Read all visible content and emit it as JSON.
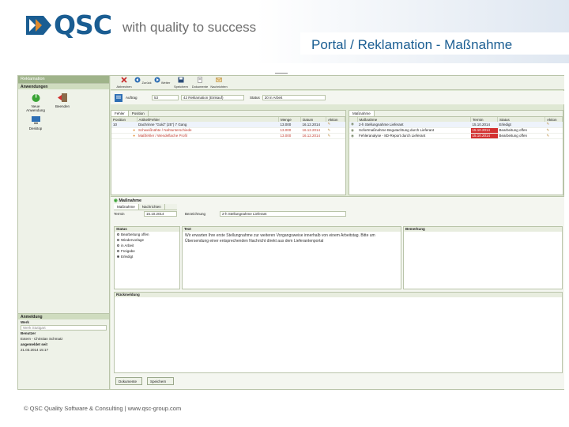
{
  "brand": {
    "name": "QSC",
    "tagline": "with quality to success",
    "color": "#1a5d92"
  },
  "slide": {
    "title": "Portal / Reklamation - Maßnahme",
    "footer": "© QSC Quality Software & Consulting | www.qsc-group.com"
  },
  "app": {
    "left_panel": {
      "title": "Reklamation",
      "section_apps": "Anwendungen",
      "apps": [
        {
          "label": "Neue Anwendung",
          "icon": "power-icon"
        },
        {
          "label": "Beenden",
          "icon": "exit-icon"
        },
        {
          "label": "Desktop",
          "icon": "desktop-icon"
        }
      ],
      "section_login": "Anmeldung",
      "werk_label": "Werk",
      "werk_placeholder": "Werk Stuttgart",
      "benutzer_label": "Benutzer",
      "benutzer_value": "Extern - Christian Schmatz",
      "angemeldet_label": "angemeldet seit",
      "angemeldet_value": "21.03.2014 15:17"
    },
    "toolbar": {
      "buttons": [
        "Abbrechen",
        "Zurück",
        "Weiter",
        "Speichern",
        "Dokumente",
        "Nachrichten"
      ]
    },
    "filter": {
      "auftrag_label": "Auftrag",
      "auftrag_value": "53",
      "reklamation_value": "42 Reklamation (Einkauf)",
      "status_label": "Status",
      "status_value": "20 in Arbeit"
    },
    "defects": {
      "tabs": [
        "Fehler",
        "Position"
      ],
      "columns": [
        "Position",
        "Artikel/Fehler",
        "Menge",
        "Datum",
        "Aktion"
      ],
      "rows": [
        {
          "position": "10",
          "artikel": "Dachrinne \"Gold\" (25\") 7 Gang",
          "menge": "13.000",
          "datum": "16.12.2014",
          "red": false
        },
        {
          "position": "",
          "artikel": "Schweißnähte / Nahtunterschiede",
          "menge": "13.000",
          "datum": "16.12.2014",
          "red": true
        },
        {
          "position": "",
          "artikel": "Maßfehler / Wendeflache Profil",
          "menge": "13.000",
          "datum": "16.12.2014",
          "red": true
        }
      ]
    },
    "measures": {
      "tab": "Maßnahme",
      "columns": [
        "Maßnahme",
        "Termin",
        "Status",
        "Aktion"
      ],
      "rows": [
        {
          "massnahme": "2-h Stellungnahme Lieferant",
          "termin": "15.10.2014",
          "status": "Erledigt",
          "red": false
        },
        {
          "massnahme": "Sofortmaßnahme Begutachtung durch Lieferant",
          "termin": "15.10.2014",
          "status": "Bearbeitung offen",
          "red": true
        },
        {
          "massnahme": "Fehleranalyse - 8D-Report durch Lieferant",
          "termin": "15.10.2014",
          "status": "Bearbeitung offen",
          "red": true
        }
      ]
    },
    "detail": {
      "title": "Maßnahme",
      "tabs": [
        "Maßnahme",
        "Nachrichten"
      ],
      "termin_label": "Termin",
      "termin_value": "15.10.2014",
      "bezeichnung_label": "Bezeichnung",
      "bezeichnung_value": "2-h Stellungnahme Lieferant",
      "status_head": "Status",
      "status_options": [
        "Bearbeitung offen",
        "Wiedervorlage",
        "in Arbeit",
        "Freigabe",
        "Erledigt"
      ],
      "status_selected": 4,
      "text_head": "Text",
      "text_value": "Wir erwarten Ihre erste Stellungnahme zur weiteren Vorgangsweise innerhalb von einem Arbeitstag. Bitte um Übersendung einer entsprechenden Nachricht direkt aus dem Lieferantenportal",
      "bemerkung_head": "Bemerkung",
      "rueckmeldung_head": "Rückmeldung",
      "btn_dokumente": "Dokumente",
      "btn_speichern": "Speichern"
    }
  }
}
